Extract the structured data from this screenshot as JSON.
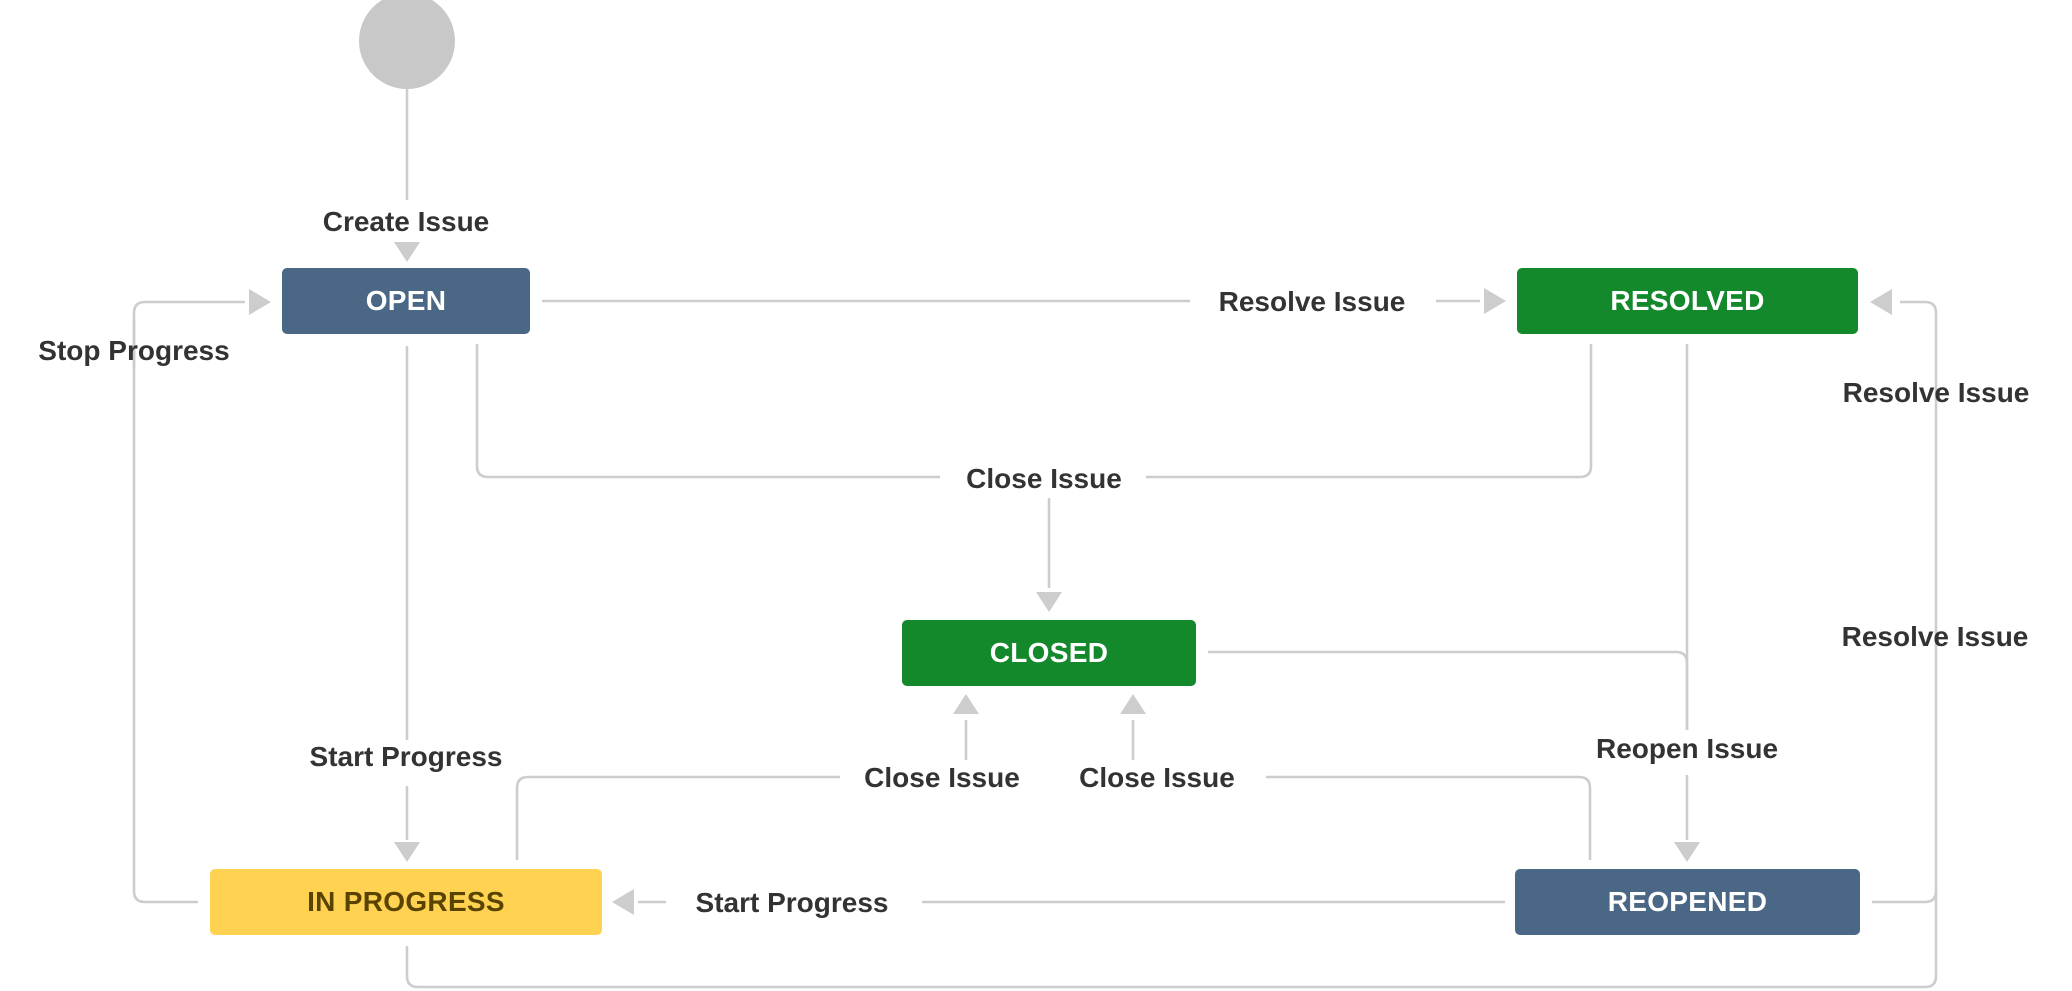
{
  "colors": {
    "edge": "#cdcdcd",
    "label_text": "#333333",
    "start_node": "#c8c8c8"
  },
  "statuses": {
    "open": {
      "label": "OPEN",
      "bg": "#4a6785",
      "fg": "#ffffff"
    },
    "resolved": {
      "label": "RESOLVED",
      "bg": "#14892c",
      "fg": "#ffffff"
    },
    "closed": {
      "label": "CLOSED",
      "bg": "#14892c",
      "fg": "#ffffff"
    },
    "in_progress": {
      "label": "IN PROGRESS",
      "bg": "#ffd351",
      "fg": "#594300"
    },
    "reopened": {
      "label": "REOPENED",
      "bg": "#4a6785",
      "fg": "#ffffff"
    }
  },
  "transitions": {
    "create_issue": "Create Issue",
    "stop_progress": "Stop Progress",
    "resolve_open_to_resolved": "Resolve Issue",
    "resolve_reopened_upper": "Resolve Issue",
    "resolve_inprogress_lower": "Resolve Issue",
    "close_issue_top": "Close Issue",
    "start_progress_open": "Start Progress",
    "close_issue_inprogress": "Close Issue",
    "close_issue_reopened": "Close Issue",
    "reopen_issue": "Reopen Issue",
    "start_progress_reopened": "Start Progress"
  }
}
